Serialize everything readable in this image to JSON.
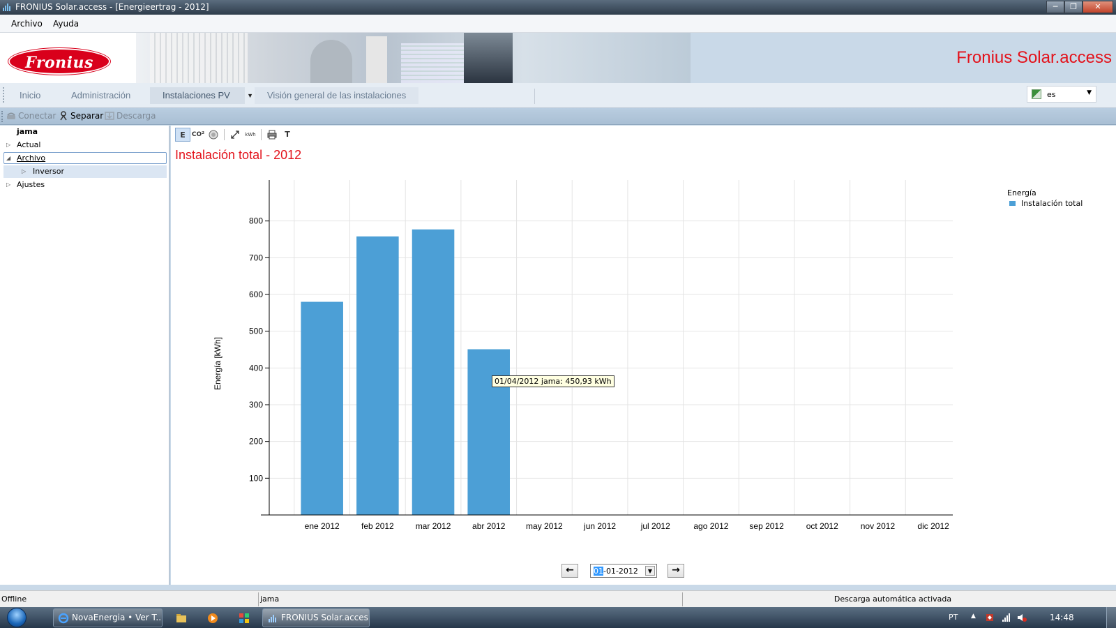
{
  "window": {
    "title": "FRONIUS Solar.access - [Energieertrag - 2012]",
    "controls": {
      "minimize": "─",
      "maximize": "❐",
      "close": "✕"
    }
  },
  "menu": {
    "items": [
      "Archivo",
      "Ayuda"
    ]
  },
  "banner": {
    "logo_text": "Fronius",
    "product_title": "Fronius Solar.access"
  },
  "nav": {
    "tabs": [
      {
        "label": "Inicio"
      },
      {
        "label": "Administración"
      },
      {
        "label": "Instalaciones PV"
      },
      {
        "label": "Visión general de las instalaciones"
      }
    ],
    "active_tab": "Instalaciones PV",
    "language": {
      "value": "es"
    }
  },
  "connection_toolbar": {
    "connect": "Conectar",
    "disconnect": "Separar",
    "download": "Descarga"
  },
  "tree": {
    "root": "jama",
    "items": [
      {
        "label": "Actual",
        "expanded": false
      },
      {
        "label": "Archivo",
        "expanded": true
      },
      {
        "label": "Inversor",
        "expanded": false
      },
      {
        "label": "Ajustes",
        "expanded": false
      }
    ]
  },
  "chart_tools": {
    "energy": "E",
    "co2": "CO²",
    "kwh": "kWh",
    "text": "T",
    "active": "E"
  },
  "chart_data": {
    "type": "bar",
    "title": "Instalación total - 2012",
    "xlabel": "",
    "ylabel": "Energía [kWh]",
    "categories": [
      "ene 2012",
      "feb 2012",
      "mar 2012",
      "abr 2012",
      "may 2012",
      "jun 2012",
      "jul 2012",
      "ago 2012",
      "sep 2012",
      "oct 2012",
      "nov 2012",
      "dic 2012"
    ],
    "series": [
      {
        "name": "Instalación total",
        "values": [
          580,
          758,
          777,
          450.93,
          null,
          null,
          null,
          null,
          null,
          null,
          null,
          null
        ],
        "color": "#4c9fd6"
      }
    ],
    "ylim": [
      0,
      900
    ],
    "yticks": [
      100,
      200,
      300,
      400,
      500,
      600,
      700,
      800
    ],
    "legend_title": "Energía",
    "legend_position": "top-right",
    "grid": true,
    "tooltip": "01/04/2012 jama: 450,93 kWh"
  },
  "date_nav": {
    "prev": "←",
    "next": "→",
    "date_sel": "01",
    "date_rest": "-01-2012"
  },
  "status": {
    "connection": "Offline",
    "system": "jama",
    "message": "Descarga automática activada"
  },
  "taskbar": {
    "tasks": [
      {
        "label": "NovaEnergia • Ver T..."
      },
      {
        "label": "FRONIUS Solar.acces..."
      }
    ],
    "language": "PT",
    "time": "14:48"
  }
}
